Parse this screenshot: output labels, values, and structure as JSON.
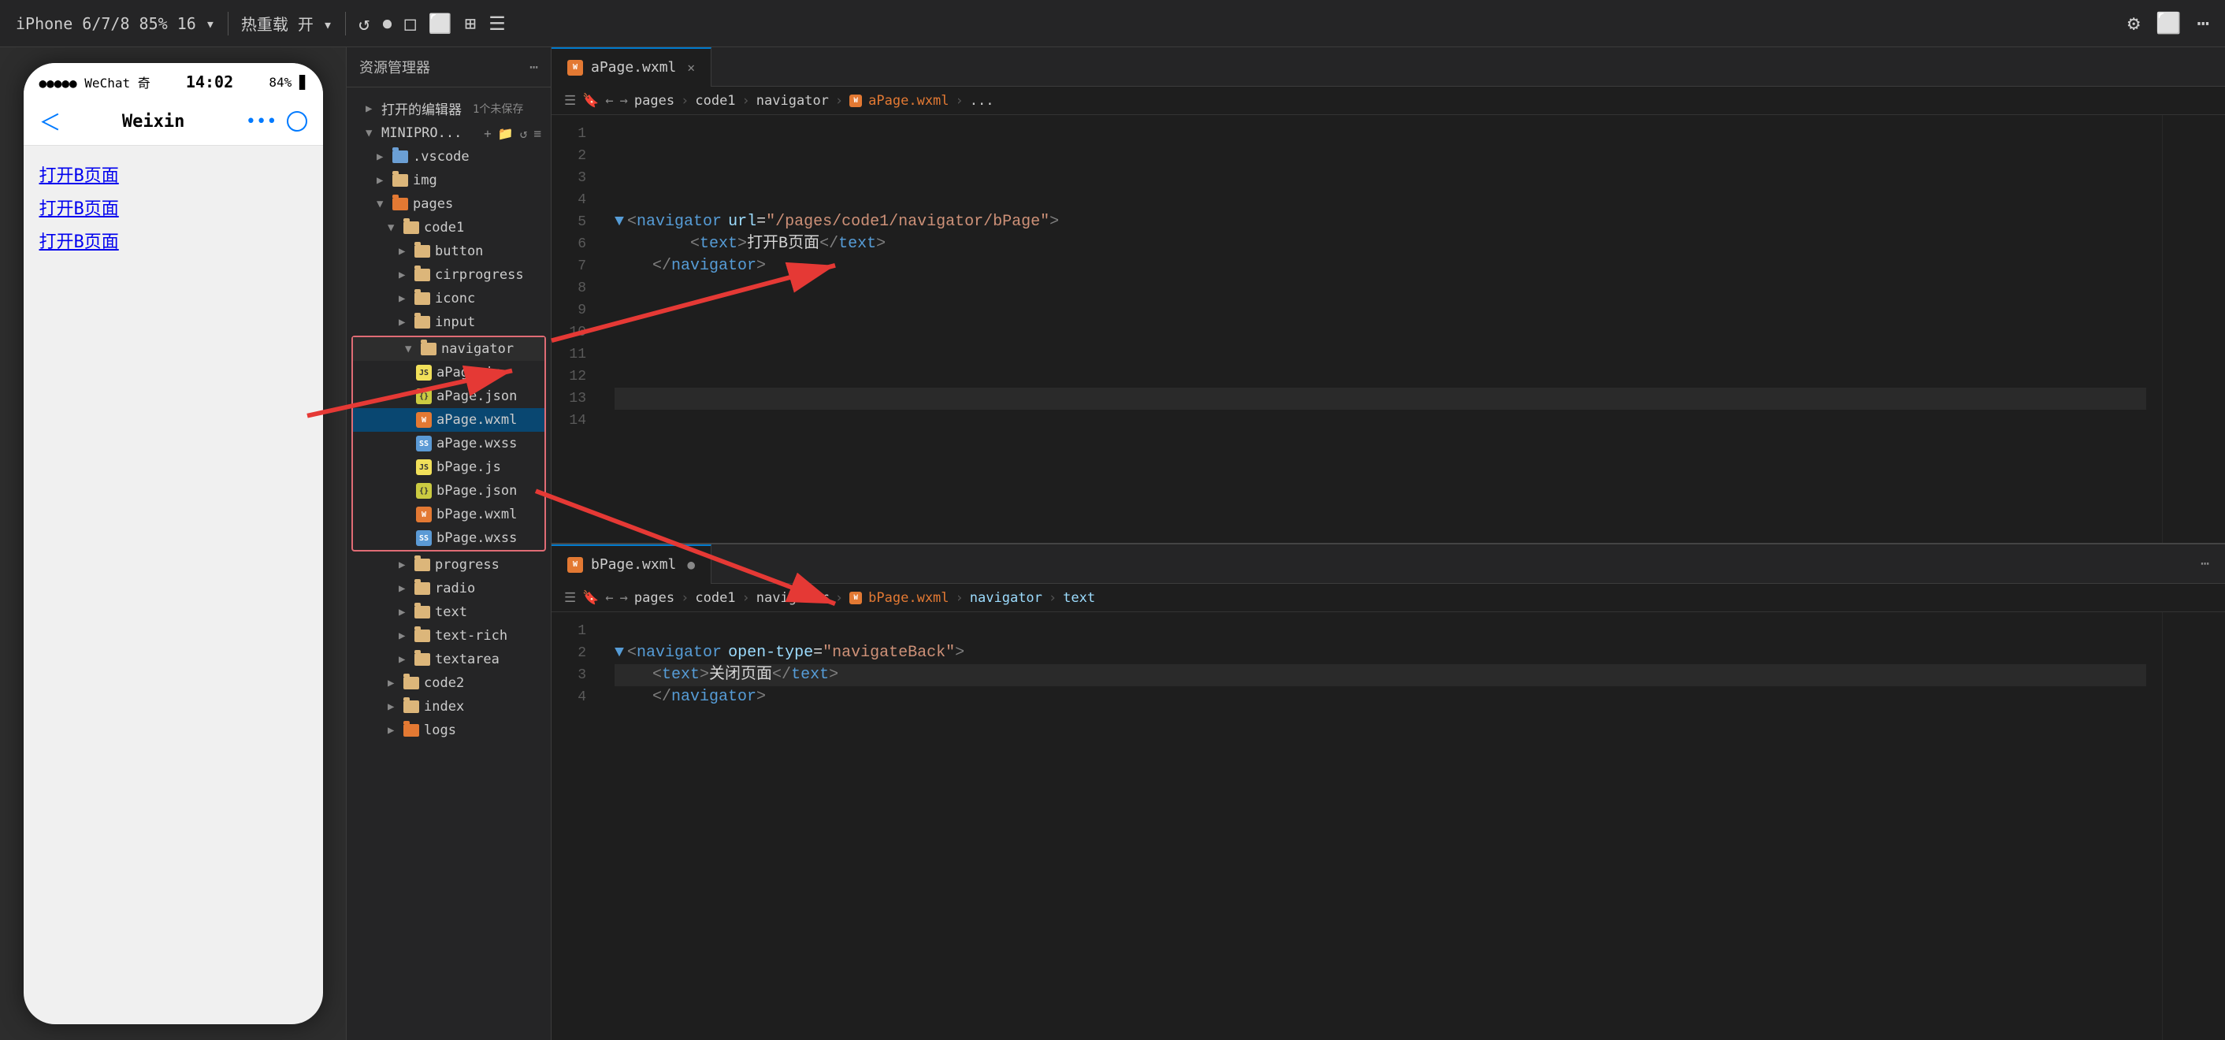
{
  "toolbar": {
    "device": "iPhone 6/7/8 85% 16 ▾",
    "hotreload": "热重载 开 ▾",
    "icons": [
      "↺",
      "⏺",
      "□",
      "⬜",
      "⊞",
      "☰",
      "☰"
    ]
  },
  "explorer": {
    "title": "资源管理器",
    "openEditors": {
      "label": "打开的编辑器",
      "badge": "1个未保存"
    },
    "projectLabel": "MINIPRO...",
    "tree": {
      "vscode": ".vscode",
      "img": "img",
      "pages": "pages",
      "code1": "code1",
      "button": "button",
      "cirprogress": "cirprogress",
      "iconc": "iconc",
      "input": "input",
      "navigator": "navigator",
      "aPageJs": "aPage.js",
      "aPageJson": "aPage.json",
      "aPageWxml": "aPage.wxml",
      "aPageWxss": "aPage.wxss",
      "bPageJs": "bPage.js",
      "bPageJson": "bPage.json",
      "bPageWxml": "bPage.wxml",
      "bPageWxss": "bPage.wxss",
      "progress": "progress",
      "radio": "radio",
      "text": "text",
      "textRich": "text-rich",
      "textarea": "textarea",
      "code2": "code2",
      "index": "index",
      "logs": "logs"
    }
  },
  "editor1": {
    "tab": "aPage.wxml",
    "breadcrumb": {
      "pages": "pages",
      "code1": "code1",
      "navigator": "navigator",
      "file": "aPage.wxml",
      "ellipsis": "..."
    },
    "lines": {
      "1": "",
      "2": "",
      "3": "",
      "4": "",
      "5": "    <navigator url=\"/pages/code1/navigator/bPage\">",
      "6": "        <text>打开B页面</text>",
      "7": "    </navigator>",
      "8": "",
      "9": "",
      "10": "",
      "11": "",
      "12": "",
      "13": ""
    }
  },
  "editor2": {
    "tab": "bPage.wxml",
    "hasUnsavedDot": true,
    "breadcrumb": {
      "pages": "pages",
      "code1": "code1",
      "navigator": "navigator",
      "file": "bPage.wxml",
      "navElement": "navigator",
      "textElement": "text"
    },
    "lines": {
      "1": "",
      "2": "    <navigator open-type=\"navigateBack\">",
      "3": "        <text>关闭页面</text>",
      "4": "    </navigator>"
    }
  },
  "phone": {
    "statusBar": {
      "signal": "●●●●● WeChat",
      "wifi": "奇",
      "time": "14:02",
      "battery": "84%"
    },
    "navTitle": "Weixin",
    "links": [
      "打开B页面",
      "打开B页面",
      "打开B页面"
    ]
  },
  "arrows": {
    "colors": {
      "red": "#e53935"
    }
  }
}
